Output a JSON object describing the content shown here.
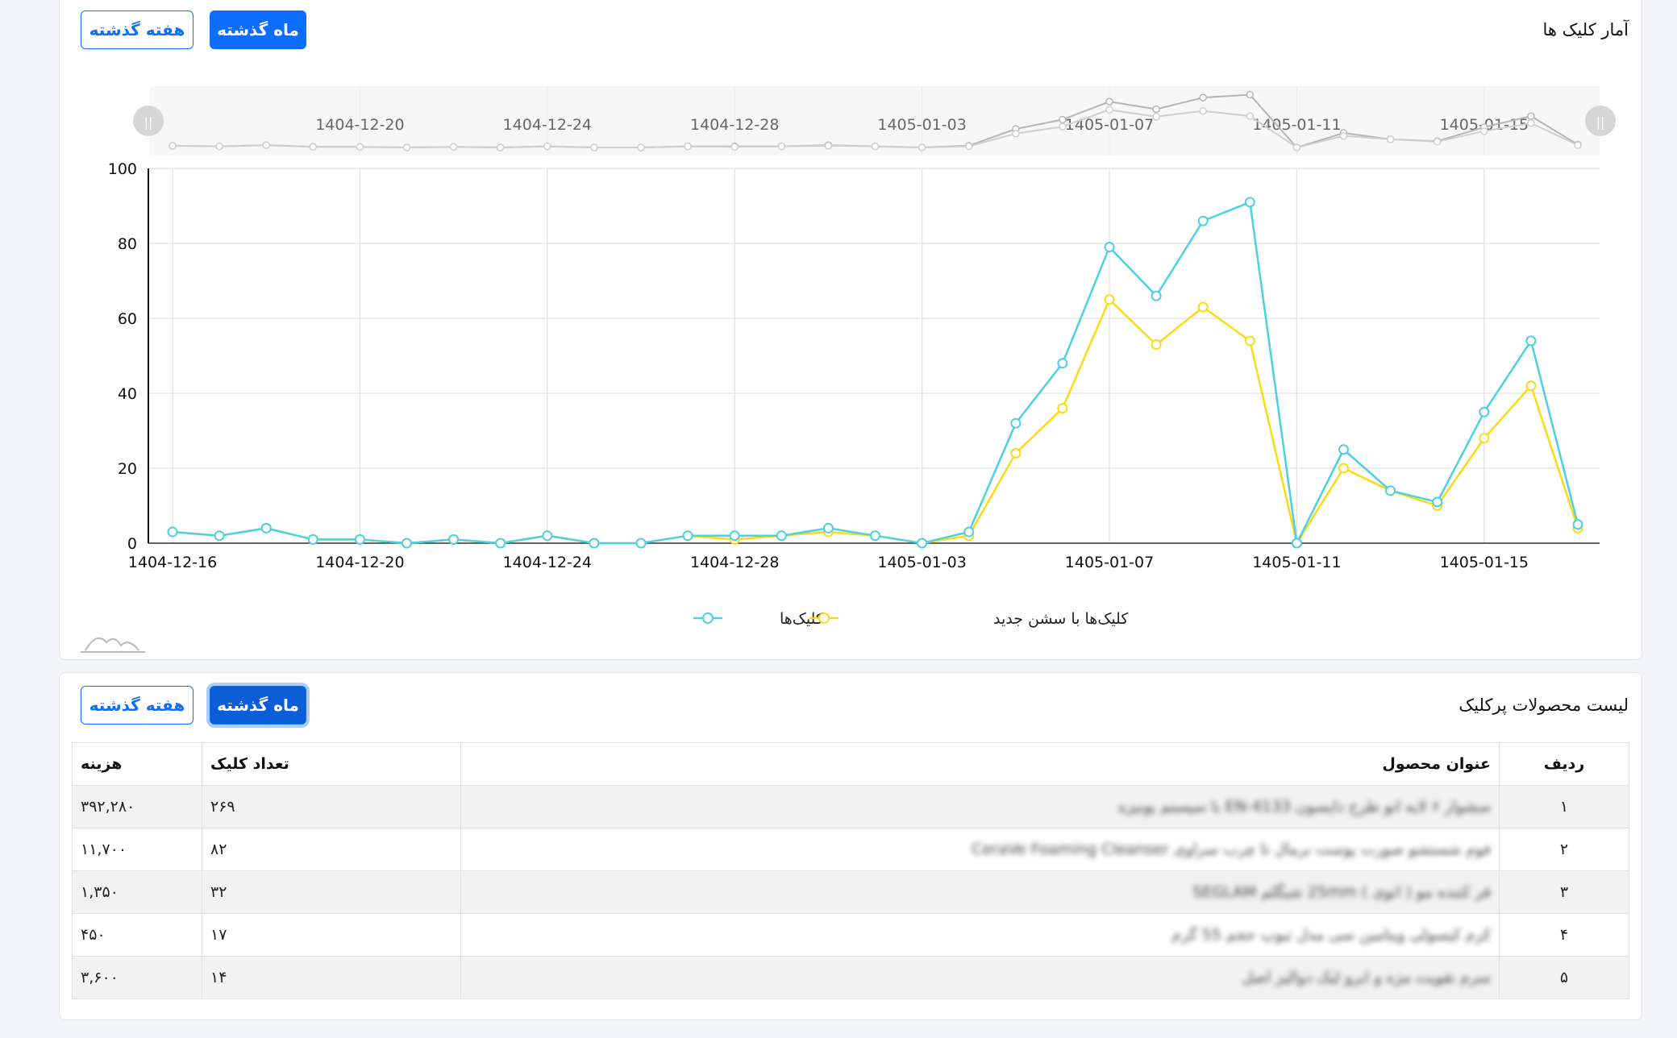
{
  "clicks_card": {
    "title": "آمار کلیک ها",
    "btn_month": "ماه گذشته",
    "btn_week": "هفته گذشته"
  },
  "chart_data": {
    "type": "line",
    "x": [
      "1404-12-16",
      "1404-12-17",
      "1404-12-18",
      "1404-12-19",
      "1404-12-20",
      "1404-12-21",
      "1404-12-22",
      "1404-12-23",
      "1404-12-24",
      "1404-12-25",
      "1404-12-26",
      "1404-12-27",
      "1404-12-28",
      "1404-12-29",
      "1405-01-01",
      "1405-01-02",
      "1405-01-03",
      "1405-01-04",
      "1405-01-05",
      "1405-01-06",
      "1405-01-07",
      "1405-01-08",
      "1405-01-09",
      "1405-01-10",
      "1405-01-11",
      "1405-01-12",
      "1405-01-13",
      "1405-01-14",
      "1405-01-15",
      "1405-01-16",
      "1405-01-17"
    ],
    "x_ticks": [
      "1404-12-16",
      "1404-12-20",
      "1404-12-24",
      "1404-12-28",
      "1405-01-03",
      "1405-01-07",
      "1405-01-11",
      "1405-01-15"
    ],
    "zoom_ticks": [
      "1404-12-20",
      "1404-12-24",
      "1404-12-28",
      "1405-01-03",
      "1405-01-07",
      "1405-01-11",
      "1405-01-15"
    ],
    "y_ticks": [
      "0",
      "20",
      "40",
      "60",
      "80",
      "100"
    ],
    "ylim": [
      0,
      100
    ],
    "series": [
      {
        "name": "کلیک‌ها",
        "color": "#4dd0e1",
        "values": [
          3,
          2,
          4,
          1,
          1,
          0,
          1,
          0,
          2,
          0,
          0,
          2,
          2,
          2,
          4,
          2,
          0,
          3,
          32,
          48,
          79,
          66,
          86,
          91,
          0,
          25,
          14,
          11,
          35,
          54,
          5
        ]
      },
      {
        "name": "کلیک‌ها با سشن جدید",
        "color": "#fadb14",
        "values": [
          3,
          2,
          4,
          1,
          1,
          0,
          1,
          0,
          2,
          0,
          0,
          2,
          1,
          2,
          3,
          2,
          0,
          2,
          24,
          36,
          65,
          53,
          63,
          54,
          0,
          20,
          14,
          10,
          28,
          42,
          4
        ]
      }
    ],
    "legend_position": "bottom"
  },
  "products_card": {
    "title": "لیست محصولات پرکلیک",
    "btn_month": "ماه گذشته",
    "btn_week": "هفته گذشته",
    "headers": {
      "rank": "ردیف",
      "title": "عنوان محصول",
      "clicks": "تعداد کلیک",
      "cost": "هزینه"
    },
    "rows": [
      {
        "rank": "۱",
        "title": "سشوار ۶ لایه انو طرح دایسون EN-4133 با سیستم یونیزه",
        "clicks": "۲۶۹",
        "cost": "۳۹۲,۲۸۰"
      },
      {
        "rank": "۲",
        "title": "فوم شستشو صورت پوست نرمال تا چرب سراوی CeraVe Foaming Cleanser",
        "clicks": "۸۲",
        "cost": "۱۱,۷۰۰"
      },
      {
        "rank": "۳",
        "title": "فر کننده مو ( اتوی ) 25mm شیگلم SEGLAM",
        "clicks": "۳۲",
        "cost": "۱,۳۵۰"
      },
      {
        "rank": "۴",
        "title": "کرم کیسولی ویتامین سی مدل تیوپ حجم 55 گرم",
        "clicks": "۱۷",
        "cost": "۴۵۰"
      },
      {
        "rank": "۵",
        "title": "سرم تقویت مژه و ابرو لیک دوالیز اصل",
        "clicks": "۱۴",
        "cost": "۳,۶۰۰"
      }
    ]
  }
}
